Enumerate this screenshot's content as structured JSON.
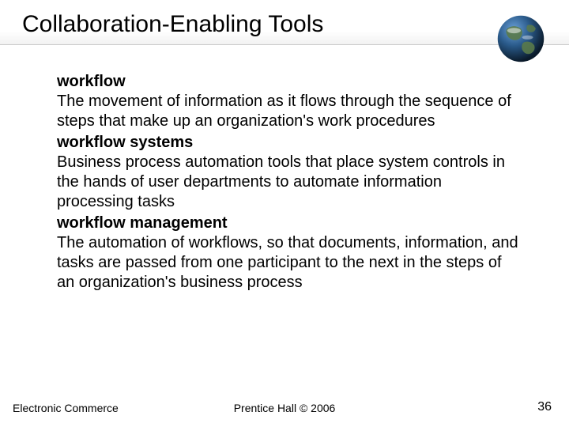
{
  "title": "Collaboration-Enabling Tools",
  "body": {
    "term1": "workflow",
    "def1": "The movement of information as it flows through the sequence of steps that make up an organization's work procedures",
    "term2": "workflow systems",
    "def2": "Business process automation tools that place system controls in the hands of user departments to automate information processing tasks",
    "term3": "workflow management",
    "def3": "The automation of workflows, so that documents, information, and tasks are passed from one participant to the next in the steps of an organization's business process"
  },
  "footer": {
    "left": "Electronic Commerce",
    "center": "Prentice Hall © 2006",
    "page": "36"
  }
}
